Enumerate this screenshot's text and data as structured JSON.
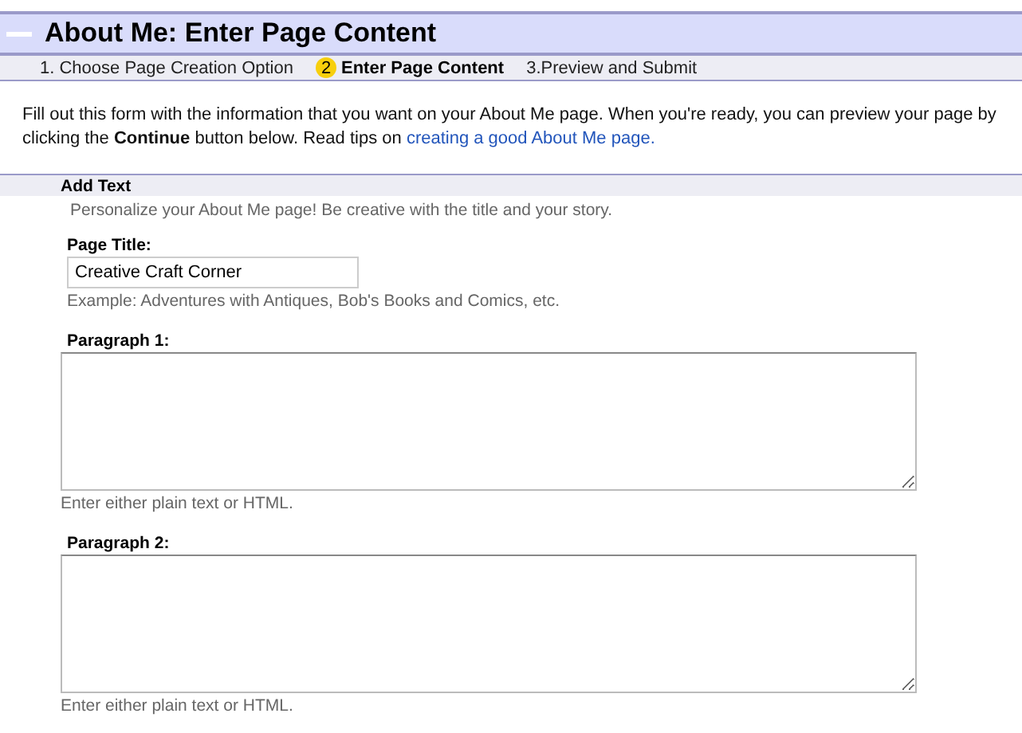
{
  "header": {
    "title": "About Me: Enter Page Content"
  },
  "steps": [
    {
      "text": "1. Choose Page Creation Option",
      "selected": false
    },
    {
      "number": "2",
      "text": "Enter Page Content",
      "selected": true
    },
    {
      "text": "3.Preview and Submit",
      "selected": false
    }
  ],
  "intro": {
    "text": "Fill out this form with the information that you want on your About Me page. When you're ready, you can preview your page by clicking the **Continue** button below. Read tips on",
    "link": "creating a good About Me page."
  },
  "section": {
    "title": "Add Text",
    "description": "Personalize your About Me page! Be creative with the title and your story."
  },
  "fields": [
    {
      "kind": "input",
      "label": "Page Title:",
      "value": "Creative Craft Corner",
      "hint": "Example: Adventures with Antiques, Bob's Books and Comics, etc."
    },
    {
      "kind": "textarea",
      "label": "Paragraph 1:",
      "hint": "Enter either plain text or HTML."
    },
    {
      "kind": "textarea",
      "label": "Paragraph 2:",
      "hint": "Enter either plain text or HTML."
    }
  ]
}
